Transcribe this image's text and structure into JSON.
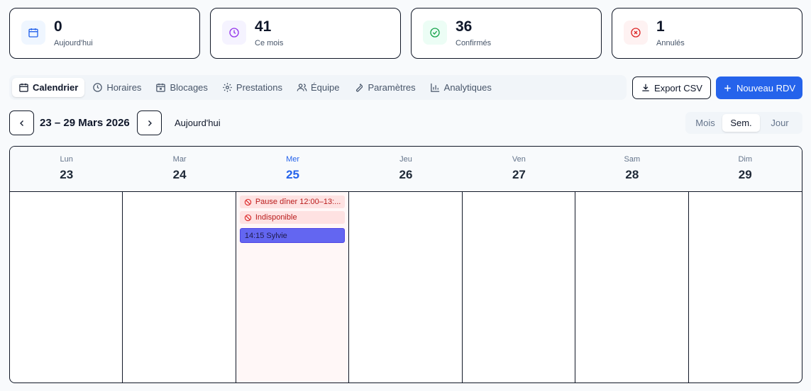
{
  "stats": [
    {
      "value": "0",
      "label": "Aujourd'hui",
      "icon": "calendar-icon",
      "bg": "#eff6ff",
      "color": "#2563eb"
    },
    {
      "value": "41",
      "label": "Ce mois",
      "icon": "clock-icon",
      "bg": "#f5f3ff",
      "color": "#9333ea"
    },
    {
      "value": "36",
      "label": "Confirmés",
      "icon": "check-circle-icon",
      "bg": "#ecfdf5",
      "color": "#16a34a"
    },
    {
      "value": "1",
      "label": "Annulés",
      "icon": "x-circle-icon",
      "bg": "#fef2f2",
      "color": "#dc2626"
    }
  ],
  "tabs": [
    {
      "label": "Calendrier",
      "icon": "calendar-icon"
    },
    {
      "label": "Horaires",
      "icon": "clock-icon"
    },
    {
      "label": "Blocages",
      "icon": "calendar-x-icon"
    },
    {
      "label": "Prestations",
      "icon": "gear-icon"
    },
    {
      "label": "Équipe",
      "icon": "users-icon"
    },
    {
      "label": "Paramètres",
      "icon": "wrench-icon"
    },
    {
      "label": "Analytiques",
      "icon": "bar-chart-icon"
    }
  ],
  "actions": {
    "export_label": "Export CSV",
    "new_label": "Nouveau RDV"
  },
  "nav": {
    "range_title": "23 – 29 Mars 2026",
    "today_label": "Aujourd'hui"
  },
  "views": [
    "Mois",
    "Sem.",
    "Jour"
  ],
  "active_view": "Sem.",
  "week": [
    {
      "dow": "Lun",
      "num": "23"
    },
    {
      "dow": "Mar",
      "num": "24"
    },
    {
      "dow": "Mer",
      "num": "25",
      "today": true
    },
    {
      "dow": "Jeu",
      "num": "26"
    },
    {
      "dow": "Ven",
      "num": "27"
    },
    {
      "dow": "Sam",
      "num": "28"
    },
    {
      "dow": "Dim",
      "num": "29"
    }
  ],
  "today_blocks": [
    "Pause dîner 12:00–13:...",
    "Indisponible"
  ],
  "today_event": "14:15 Sylvie",
  "colors": {
    "accent": "#2563eb",
    "block_bg": "#fee2e2",
    "event_bg": "#6366f1"
  }
}
